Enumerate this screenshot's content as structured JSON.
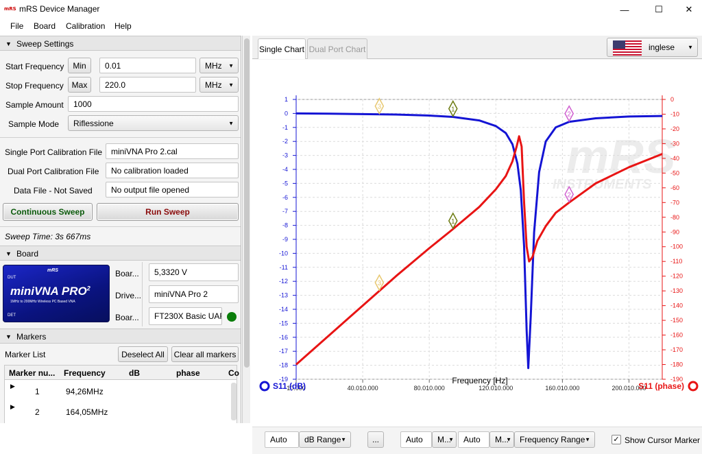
{
  "window": {
    "title": "mRS Device Manager",
    "logo_text": "mRS",
    "minimize": "—",
    "maximize": "☐",
    "close": "✕"
  },
  "menu": [
    "File",
    "Board",
    "Calibration",
    "Help"
  ],
  "sweep": {
    "section": "Sweep Settings",
    "start_label": "Start Frequency",
    "start_btn": "Min",
    "start_value": "0.01",
    "start_unit": "MHz",
    "stop_label": "Stop Frequency",
    "stop_btn": "Max",
    "stop_value": "220.0",
    "stop_unit": "MHz",
    "samples_label": "Sample Amount",
    "samples_value": "1000",
    "mode_label": "Sample Mode",
    "mode_value": "Riflessione",
    "single_cal_label": "Single Port Calibration File",
    "single_cal_value": "miniVNA Pro 2.cal",
    "dual_cal_label": "Dual Port Calibration File",
    "dual_cal_value": "No calibration loaded",
    "data_file_label": "Data File - Not Saved",
    "data_file_value": "No output file opened",
    "continuous_btn": "Continuous Sweep",
    "run_btn": "Run Sweep",
    "sweep_time": "Sweep Time: 3s 667ms"
  },
  "board": {
    "section": "Board",
    "image_title": "miniVNA PRO",
    "image_sup": "2",
    "image_brand": "mRS",
    "image_sub": "1MHz to 200MHz  Wireless PC Based VNA",
    "image_dut": "DUT",
    "image_det": "DET",
    "row1_label": "Boar...",
    "row1_value": "5,3320 V",
    "row2_label": "Drive...",
    "row2_value": "miniVNA Pro 2",
    "row3_label": "Boar...",
    "row3_value": "FT230X Basic UART",
    "status_color": "#0a7d0a"
  },
  "markers": {
    "section": "Markers",
    "list_label": "Marker List",
    "deselect_btn": "Deselect All",
    "clear_btn": "Clear all markers",
    "columns": [
      "Marker nu...",
      "Frequency",
      "dB",
      "phase",
      "Co"
    ],
    "rows": [
      {
        "num": "1",
        "freq": "94,26MHz"
      },
      {
        "num": "2",
        "freq": "164,05MHz"
      }
    ]
  },
  "tabs": {
    "single": "Single Chart",
    "dual": "Dual Port Chart"
  },
  "language": {
    "value": "inglese"
  },
  "chart_data": {
    "type": "line",
    "x_ticks": [
      "10.000",
      "40.010.000",
      "80.010.000",
      "120.010.000",
      "160.010.000",
      "200.010.000"
    ],
    "xlabel": "Frequency [Hz]",
    "xlim": [
      10000,
      220000000
    ],
    "y_left_ticks": [
      "1",
      "0",
      "-1",
      "-2",
      "-3",
      "-4",
      "-5",
      "-6",
      "-7",
      "-8",
      "-9",
      "-10",
      "-11",
      "-12",
      "-13",
      "-14",
      "-15",
      "-16",
      "-17",
      "-18",
      "-19"
    ],
    "ylim_left": [
      -19,
      1
    ],
    "y_right_ticks": [
      "0",
      "-10",
      "-20",
      "-30",
      "-40",
      "-50",
      "-60",
      "-70",
      "-80",
      "-90",
      "-100",
      "-110",
      "-120",
      "-130",
      "-140",
      "-150",
      "-160",
      "-170",
      "-180",
      "-190"
    ],
    "ylim_right": [
      -190,
      0
    ],
    "series": [
      {
        "name": "S11 (dB)",
        "color": "#1414d4",
        "x": [
          10000,
          20000000,
          40000000,
          60000000,
          80000000,
          94260000,
          110000000,
          120000000,
          126000000,
          130000000,
          133000000,
          135000000,
          137000000,
          138500000,
          139500000,
          141000000,
          143000000,
          146000000,
          150000000,
          156000000,
          164050000,
          180000000,
          200000000,
          220000000
        ],
        "y": [
          0,
          -0.02,
          -0.05,
          -0.08,
          -0.15,
          -0.25,
          -0.5,
          -0.9,
          -1.4,
          -2.2,
          -3.6,
          -5.5,
          -9.5,
          -15.5,
          -18.2,
          -14.5,
          -8.5,
          -4.2,
          -2.0,
          -1.0,
          -0.6,
          -0.35,
          -0.22,
          -0.18
        ]
      },
      {
        "name": "S11 (phase)",
        "color": "#e81414",
        "x": [
          10000,
          20000000,
          40000000,
          60000000,
          80000000,
          94260000,
          110000000,
          120000000,
          126000000,
          130000000,
          132500000,
          134000000,
          135500000,
          137000000,
          138500000,
          140000000,
          142000000,
          145000000,
          150000000,
          156000000,
          164050000,
          180000000,
          200000000,
          220000000
        ],
        "y": [
          -180,
          -160,
          -140,
          -120,
          -101,
          -88,
          -73,
          -61,
          -52,
          -42,
          -32,
          -25,
          -32,
          -70,
          -100,
          -110,
          -107,
          -96,
          -86,
          -77,
          -70,
          -57,
          -46,
          -37
        ]
      }
    ],
    "markers": [
      {
        "label": "1",
        "x": 94260000,
        "color": "#6b7a10"
      },
      {
        "label": "2",
        "x": 164050000,
        "color": "#d060d0"
      },
      {
        "label": "3",
        "x": 50000000,
        "color": "#e8c870"
      }
    ],
    "grid": true,
    "watermark_main": "mRS",
    "watermark_sub": "INSTRUMENTS",
    "legend_left": "S11 (dB)",
    "legend_right": "S11 (phase)"
  },
  "bottom": {
    "auto1": "Auto",
    "db_range": "dB Range",
    "dots": "...",
    "auto2": "Auto",
    "m1": "M...",
    "auto3": "Auto",
    "m2": "M...",
    "freq_range": "Frequency Range",
    "cursor_label": "Show Cursor Marker",
    "cursor_checked": "✓"
  }
}
